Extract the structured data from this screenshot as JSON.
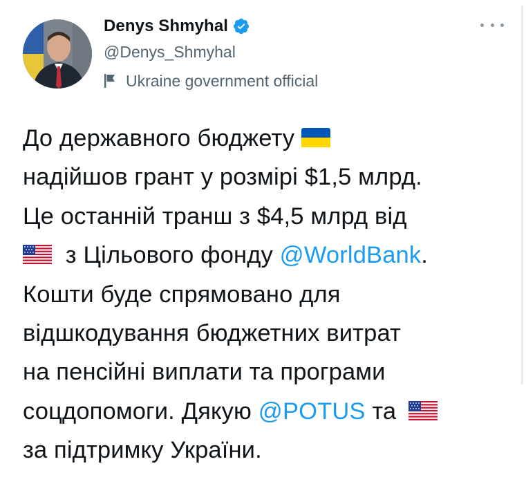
{
  "author": {
    "display_name": "Denys Shmyhal",
    "handle": "@Denys_Shmyhal",
    "account_label": "Ukraine government official",
    "verified": true
  },
  "icons": {
    "verified": "verified-badge-icon",
    "label": "flag-icon",
    "more": "more-options-icon",
    "ukraine_flag": "ukraine-flag-emoji",
    "us_flag": "us-flag-emoji"
  },
  "colors": {
    "mention": "#1d9bf0",
    "secondary_text": "#536471",
    "verified": "#1d9bf0",
    "ua_blue": "#0057b7",
    "ua_yellow": "#ffd700"
  },
  "tweet": {
    "line1": "До державного бюджету",
    "line2": "надійшов грант у розмірі $1,5 млрд.",
    "line3": "Це останній транш з $4,5 млрд від",
    "line4_pre": "з Цільового фонду ",
    "mention_worldbank": "@WorldBank",
    "line4_post": ".",
    "line5": "Кошти буде спрямовано для",
    "line6": "відшкодування бюджетних витрат",
    "line7": "на пенсійні виплати та програми",
    "line8_pre": "соцдопомоги. Дякую ",
    "mention_potus": "@POTUS",
    "line8_post": " та",
    "line9": "за підтримку України."
  }
}
